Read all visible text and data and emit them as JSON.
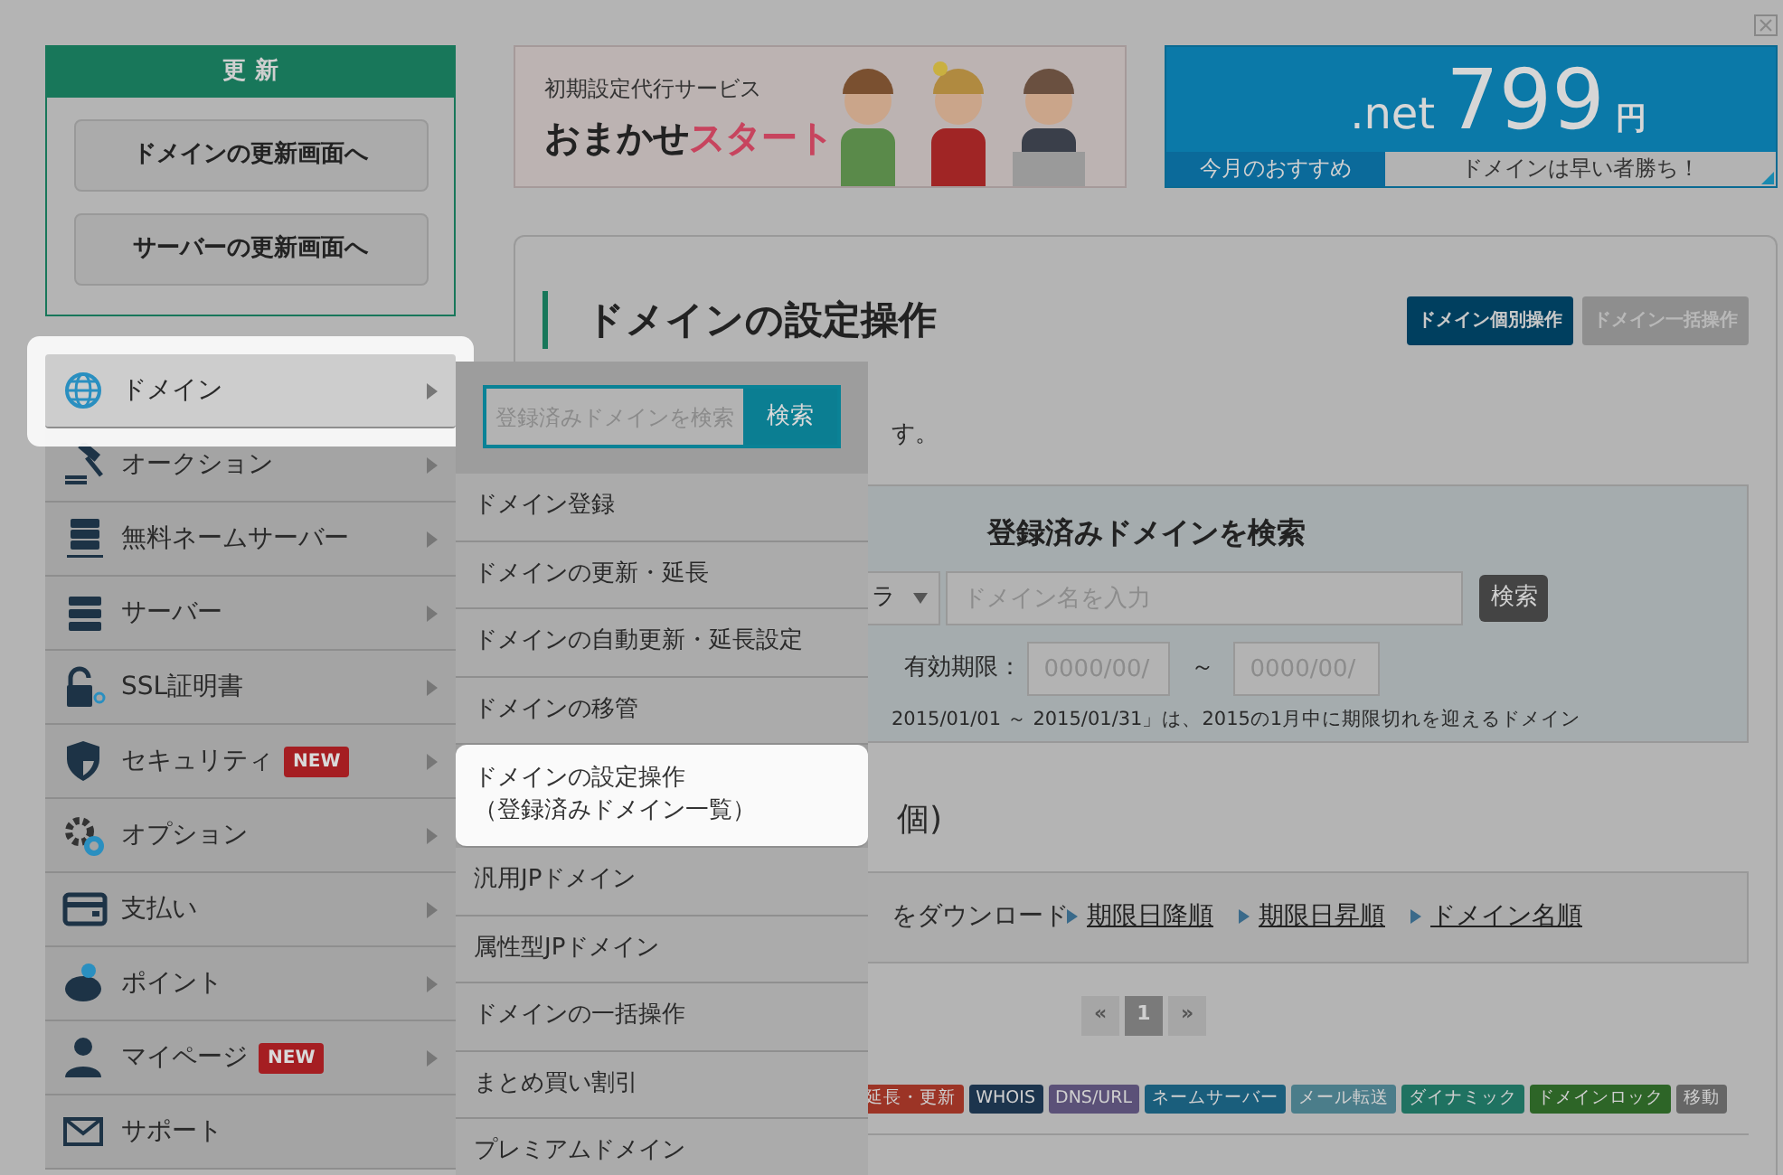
{
  "renewal": {
    "title": "更 新",
    "buttons": [
      "ドメインの更新画面へ",
      "サーバーの更新画面へ"
    ]
  },
  "sidebar": {
    "items": [
      {
        "label": "ドメイン",
        "submenu": true,
        "selected": true
      },
      {
        "label": "オークション",
        "submenu": true,
        "selected": false
      },
      {
        "label": "無料ネームサーバー",
        "submenu": true,
        "selected": false
      },
      {
        "label": "サーバー",
        "submenu": true,
        "selected": false
      },
      {
        "label": "SSL証明書",
        "submenu": true,
        "selected": false
      },
      {
        "label": "セキュリティ",
        "badge": "NEW",
        "submenu": true,
        "selected": false
      },
      {
        "label": "オプション",
        "submenu": true,
        "selected": false
      },
      {
        "label": "支払い",
        "submenu": true,
        "selected": false
      },
      {
        "label": "ポイント",
        "submenu": true,
        "selected": false
      },
      {
        "label": "マイページ",
        "badge": "NEW",
        "submenu": true,
        "selected": false
      },
      {
        "label": "サポート",
        "submenu": false,
        "selected": false
      }
    ]
  },
  "flyout": {
    "search_placeholder": "登録済みドメインを検索",
    "search_button": "検索",
    "items": [
      {
        "label": "ドメイン登録",
        "selected": false
      },
      {
        "label": "ドメインの更新・延長",
        "selected": false
      },
      {
        "label": "ドメインの自動更新・延長設定",
        "selected": false
      },
      {
        "label": "ドメインの移管",
        "selected": false
      },
      {
        "label": "ドメインの設定操作",
        "sublabel": "（登録済みドメイン一覧）",
        "selected": true
      },
      {
        "label": "汎用JPドメイン",
        "selected": false
      },
      {
        "label": "属性型JPドメイン",
        "selected": false
      },
      {
        "label": "ドメインの一括操作",
        "selected": false
      },
      {
        "label": "まとめ買い割引",
        "selected": false
      },
      {
        "label": "プレミアムドメイン",
        "selected": false
      }
    ]
  },
  "banners": [
    {
      "kind": "service",
      "caption": "初期設定代行サービス",
      "title": "おまかせ",
      "title_accent": "スタート"
    },
    {
      "kind": "price",
      "tld": ".net",
      "price": "799",
      "unit": "円",
      "left_caption": "今月のおすすめ",
      "right_caption": "ドメインは早い者勝ち！"
    }
  ],
  "main": {
    "title": "ドメインの設定操作",
    "mode_tabs": [
      {
        "label": "ドメイン個別操作",
        "selected": true
      },
      {
        "label": "ドメイン一括操作",
        "selected": false
      }
    ],
    "intro": "す。",
    "search": {
      "title": "登録済みドメインを検索",
      "select_value": "ラ",
      "placeholder": "ドメイン名を入力",
      "button": "検索",
      "expiry_label": "有効期限：",
      "from_placeholder": "0000/00/",
      "separator": "～",
      "to_placeholder": "0000/00/",
      "note": "2015/01/01 ～ 2015/01/31」は、2015の1月中に期限切れを迎えるドメイン"
    },
    "count_heading": "個)",
    "toolbar": {
      "download": "をダウンロード",
      "sort_links": [
        "期限日降順",
        "期限日昇順",
        "ドメイン名順"
      ]
    },
    "paginations": [
      [
        {
          "label": "«",
          "selected": false
        },
        {
          "label": "1",
          "selected": true
        },
        {
          "label": "»",
          "selected": false
        }
      ]
    ],
    "tags": [
      {
        "label": "延長・更新",
        "color": "#9c3426"
      },
      {
        "label": "WHOIS",
        "color": "#1c344d"
      },
      {
        "label": "DNS/URL",
        "color": "#5b5178"
      },
      {
        "label": "ネームサーバー",
        "color": "#1a5e7c"
      },
      {
        "label": "メール転送",
        "color": "#4b7d8a"
      },
      {
        "label": "ダイナミック",
        "color": "#1f7261"
      },
      {
        "label": "ドメインロック",
        "color": "#2d6527"
      },
      {
        "label": "移動",
        "color": "#666666"
      }
    ]
  }
}
